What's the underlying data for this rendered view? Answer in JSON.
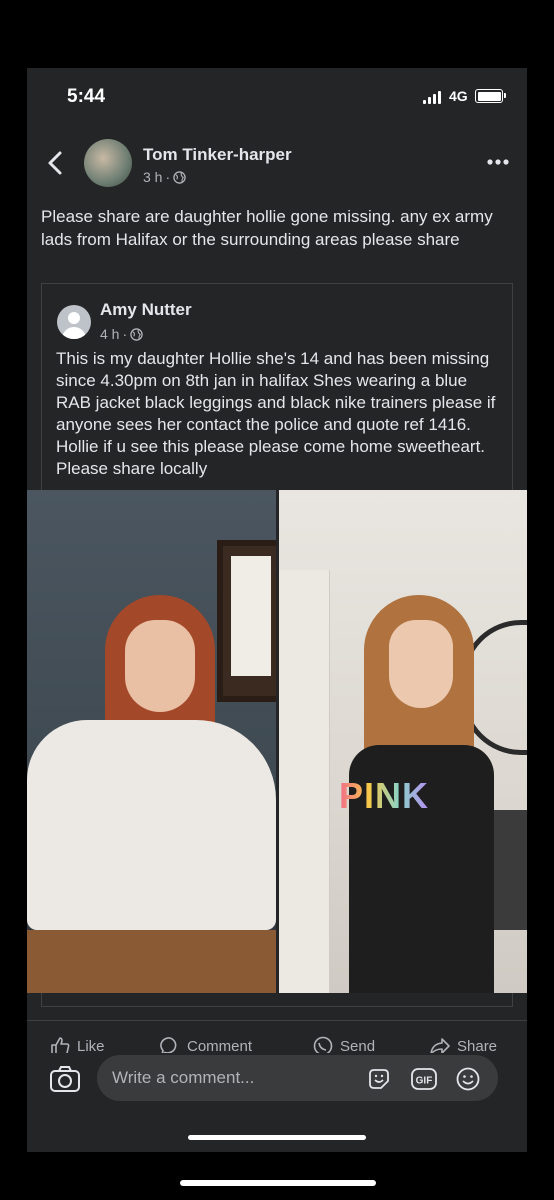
{
  "status_bar": {
    "time": "5:44",
    "network": "4G"
  },
  "post": {
    "author": "Tom Tinker-harper",
    "time": "3 h",
    "separator": "·",
    "text": "Please share are daughter hollie gone missing. any ex army lads from Halifax or the surrounding areas please share"
  },
  "shared_post": {
    "author": "Amy Nutter",
    "time": "4 h",
    "separator": "·",
    "text": "This is my daughter Hollie she's 14 and has been missing since 4.30pm on 8th jan in halifax Shes wearing a blue RAB jacket  black leggings and black nike trainers please if anyone sees her contact the police and quote ref 1416. Hollie if u see this please please come home sweetheart. Please share locally"
  },
  "photos": {
    "shirt_text": "PINK"
  },
  "actions": {
    "like": "Like",
    "comment": "Comment",
    "send": "Send",
    "share": "Share"
  },
  "comment_bar": {
    "placeholder": "Write a comment...",
    "gif_label": "GIF"
  },
  "icons": [
    "back-icon",
    "globe-icon",
    "more-icon",
    "like-icon",
    "comment-icon",
    "send-icon",
    "share-icon",
    "camera-icon",
    "sticker-icon",
    "gif-icon",
    "emoji-icon"
  ]
}
